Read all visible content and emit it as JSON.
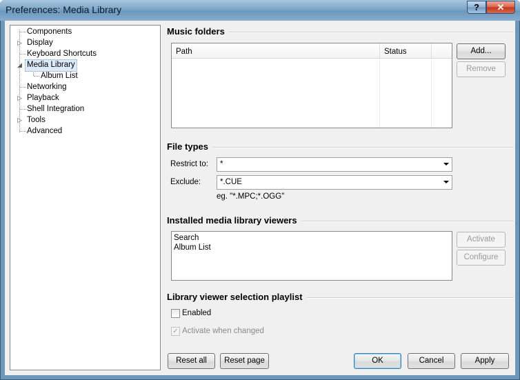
{
  "window": {
    "title": "Preferences: Media Library",
    "help_label": "?",
    "close_label": "✕"
  },
  "tree": {
    "items": [
      {
        "label": "Components",
        "has_arrow": false,
        "expanded": false,
        "level": 0,
        "selected": false
      },
      {
        "label": "Display",
        "has_arrow": true,
        "expanded": false,
        "level": 0,
        "selected": false
      },
      {
        "label": "Keyboard Shortcuts",
        "has_arrow": false,
        "expanded": false,
        "level": 0,
        "selected": false
      },
      {
        "label": "Media Library",
        "has_arrow": true,
        "expanded": true,
        "level": 0,
        "selected": true
      },
      {
        "label": "Album List",
        "has_arrow": false,
        "expanded": false,
        "level": 1,
        "selected": false
      },
      {
        "label": "Networking",
        "has_arrow": false,
        "expanded": false,
        "level": 0,
        "selected": false
      },
      {
        "label": "Playback",
        "has_arrow": true,
        "expanded": false,
        "level": 0,
        "selected": false
      },
      {
        "label": "Shell Integration",
        "has_arrow": false,
        "expanded": false,
        "level": 0,
        "selected": false
      },
      {
        "label": "Tools",
        "has_arrow": true,
        "expanded": false,
        "level": 0,
        "selected": false
      },
      {
        "label": "Advanced",
        "has_arrow": false,
        "expanded": false,
        "level": 0,
        "selected": false
      }
    ],
    "icons": {
      "collapsed": "▷",
      "expanded": "◢"
    }
  },
  "music_folders": {
    "title": "Music folders",
    "columns": [
      "Path",
      "Status"
    ],
    "add_label": "Add...",
    "remove_label": "Remove"
  },
  "file_types": {
    "title": "File types",
    "restrict_label": "Restrict to:",
    "restrict_value": "*",
    "exclude_label": "Exclude:",
    "exclude_value": "*.CUE",
    "hint": "eg. \"*.MPC;*.OGG\""
  },
  "viewers": {
    "title": "Installed media library viewers",
    "items": [
      "Search",
      "Album List"
    ],
    "activate_label": "Activate",
    "configure_label": "Configure"
  },
  "playlist": {
    "title": "Library viewer selection playlist",
    "enabled_label": "Enabled",
    "enabled_checked": false,
    "activate_changed_label": "Activate when changed",
    "activate_changed_checked": true,
    "check_mark": "✓"
  },
  "footer": {
    "reset_all_label": "Reset all",
    "reset_page_label": "Reset page",
    "ok_label": "OK",
    "cancel_label": "Cancel",
    "apply_label": "Apply"
  }
}
